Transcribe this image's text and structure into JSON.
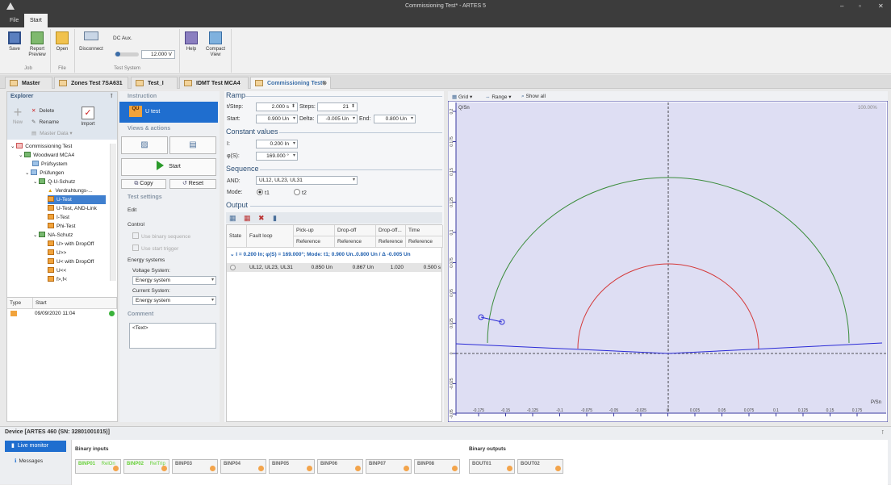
{
  "window": {
    "title": "Commissioning Test* - ARTES 5",
    "controls": [
      "–",
      "▫",
      "✕"
    ]
  },
  "menu": {
    "file": "File",
    "start": "Start"
  },
  "ribbon": {
    "save": "Save",
    "report_preview": "Report Preview",
    "open": "Open",
    "disconnect": "Disconnect",
    "dc_aux": "DC Aux.",
    "dc_value": "12.000 V",
    "help": "Help",
    "compact_view": "Compact View",
    "groups": {
      "job": "Job",
      "file": "File",
      "test_system": "Test System"
    }
  },
  "tabs": [
    "Master data",
    "Zones Test 7SA631",
    "Test_I",
    "IDMT Test MCA4",
    "Commissioning Test*"
  ],
  "explorer": {
    "title": "Explorer",
    "new": "New",
    "delete": "Delete",
    "rename": "Rename",
    "master_data": "Master Data",
    "import": "Import",
    "tree": [
      "Commissioning Test",
      "Woodward MCA4",
      "Prüfsystem",
      "Prüfungen",
      "Q-U-Schutz",
      "Verdrahtungs-...",
      "U-Test",
      "U-Test, AND-Link",
      "I-Test",
      "Phi-Test",
      "NA-Schutz",
      "U> with DropOff",
      "U>>",
      "U< with DropOff",
      "U<<",
      "f>,f<"
    ]
  },
  "log": {
    "col_type": "Type",
    "col_start": "Start",
    "row_date": "09/09/2020 11:04"
  },
  "instruction": {
    "title": "Instruction",
    "test_name": "U test",
    "views_actions": "Views & actions",
    "start": "Start",
    "copy": "Copy",
    "reset": "Reset",
    "test_settings": "Test settings",
    "edit": "Edit",
    "control": "Control",
    "use_binary": "Use binary sequence",
    "use_start": "Use start trigger",
    "energy_systems": "Energy systems",
    "voltage_system": "Voltage System:",
    "voltage_value": "Energy system",
    "current_system": "Current System:",
    "current_value": "Energy system",
    "comment": "Comment",
    "comment_text": "<Text>"
  },
  "ramp": {
    "title": "Ramp",
    "tstep_label": "t/Step:",
    "tstep": "2.000 s",
    "steps_label": "Steps:",
    "steps": "21",
    "start_label": "Start:",
    "start": "0.900 Un",
    "delta_label": "Delta:",
    "delta": "-0.005 Un",
    "end_label": "End:",
    "end": "0.800 Un"
  },
  "constant": {
    "title": "Constant values",
    "i_label": "I:",
    "i": "0.200 In",
    "phi_label": "φ(S):",
    "phi": "169.000 °"
  },
  "sequence": {
    "title": "Sequence",
    "and_label": "AND:",
    "and_value": "UL12, UL23, UL31",
    "mode_label": "Mode:",
    "t1": "t1",
    "t2": "t2"
  },
  "output": {
    "title": "Output",
    "headers": {
      "state": "State",
      "fault_loop": "Fault loop",
      "pickup": "Pick-up",
      "dropoff": "Drop-off",
      "dropoff2": "Drop-off...",
      "time": "Time",
      "reference": "Reference"
    },
    "group_row": "I = 0.200 In; φ(S) = 169.000°; Mode: t1; 0.900 Un..0.800 Un / Δ -0.005 Un",
    "row": {
      "loop": "UL12, UL23, UL31",
      "pickup": "0.850 Un",
      "dropoff": "0.867 Un",
      "ratio": "1.020",
      "time": "0.500 s"
    }
  },
  "chart": {
    "grid": "Grid",
    "range": "Range",
    "show_all": "Show all",
    "zoom": "100.00%",
    "y_axis_label": "Q/Sn",
    "x_axis_label": "P/Sn",
    "x_ticks": [
      "-0.175",
      "-0.15",
      "-0.125",
      "-0.1",
      "-0.075",
      "-0.05",
      "-0.025",
      "0",
      "0.025",
      "0.05",
      "0.075",
      "0.1",
      "0.125",
      "0.15",
      "0.175"
    ],
    "y_ticks": [
      "0.2",
      "0.175",
      "0.15",
      "0.125",
      "0.1",
      "0.075",
      "0.05",
      "0.025",
      "0",
      "-0.025",
      "-0.05"
    ]
  },
  "device": {
    "title": "Device [ARTES 460 (SN: 32801001015)]",
    "live_monitor": "Live monitor",
    "messages": "Messages",
    "binary_inputs": "Binary inputs",
    "binary_outputs": "Binary outputs",
    "binp": [
      {
        "name": "BINP01",
        "sub": "RelOn"
      },
      {
        "name": "BINP02",
        "sub": "RelTrip"
      },
      {
        "name": "BINP03",
        "sub": ""
      },
      {
        "name": "BINP04",
        "sub": ""
      },
      {
        "name": "BINP05",
        "sub": ""
      },
      {
        "name": "BINP06",
        "sub": ""
      },
      {
        "name": "BINP07",
        "sub": ""
      },
      {
        "name": "BINP08",
        "sub": ""
      }
    ],
    "bout": [
      "BOUT01",
      "BOUT02"
    ]
  }
}
